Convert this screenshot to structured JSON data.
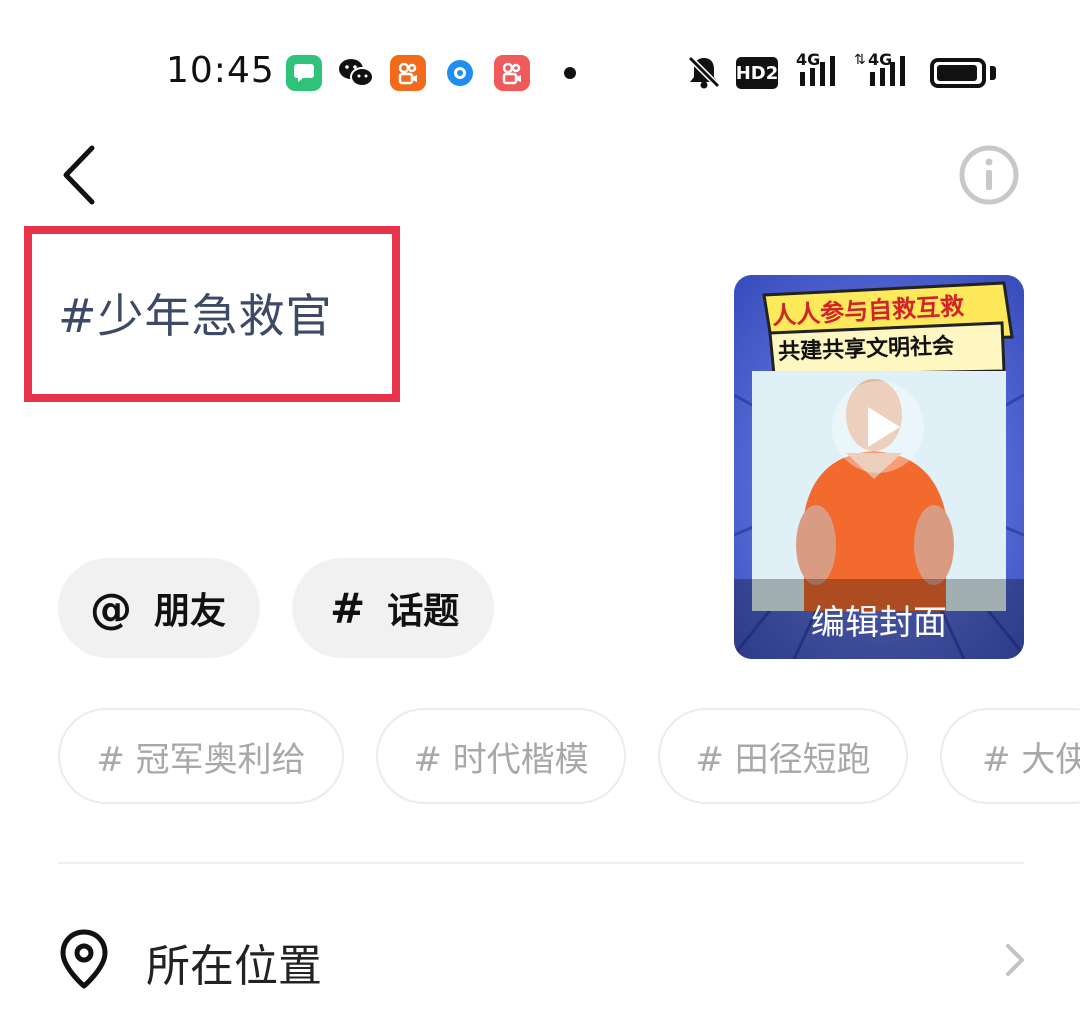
{
  "status_bar": {
    "time": "10:45",
    "icons_left": [
      "message-app-icon",
      "wechat-icon",
      "kuaishou-icon",
      "browser-icon",
      "kuaishou-lite-icon"
    ],
    "icons_right": [
      "mute-icon",
      "hd2-icon",
      "4g-signal-icon",
      "4g-signal-2-icon",
      "battery-icon"
    ],
    "hd_label": "HD2",
    "net1": "4G",
    "net2": "4G"
  },
  "header": {
    "back_icon": "chevron-left-icon",
    "info_icon": "info-icon"
  },
  "post": {
    "caption": "#少年急救官"
  },
  "cover": {
    "banner_line1": "人人参与自救互救",
    "banner_line2": "共建共享文明社会",
    "edit_label": "编辑封面"
  },
  "actions": {
    "mention_glyph": "@",
    "mention_label": "朋友",
    "topic_glyph": "#",
    "topic_label": "话题"
  },
  "suggested_topics": [
    "# 冠军奥利给",
    "# 时代楷模",
    "# 田径短跑",
    "# 大侠"
  ],
  "location": {
    "label": "所在位置"
  },
  "colors": {
    "highlight_border": "#e8334a",
    "caption_text": "#3d4a66",
    "chip_bg": "#f1f1f1",
    "topic_text": "#a8a8a8"
  }
}
